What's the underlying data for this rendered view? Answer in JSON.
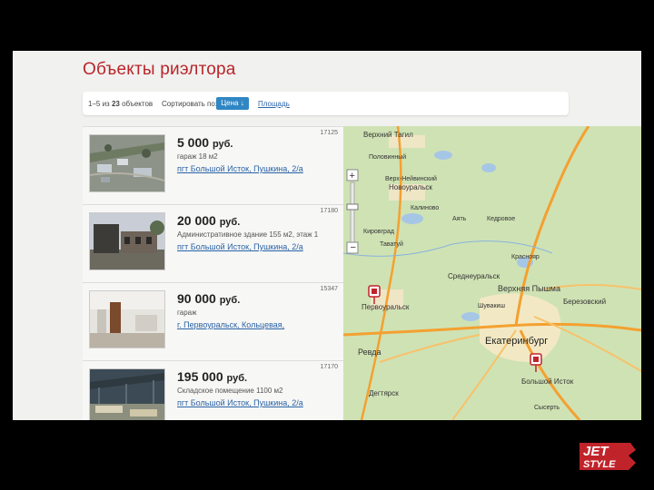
{
  "page": {
    "title": "Объекты риэлтора"
  },
  "toolbar": {
    "count_prefix": "1–5 из",
    "count_total": "23",
    "count_suffix": "объектов",
    "sort_label": "Сортировать по:",
    "sort_price": "Цена ↓",
    "sort_area": "Площадь"
  },
  "listings": [
    {
      "price": "5 000",
      "currency": "руб.",
      "desc": "гараж 18 м2",
      "address": "пгт Большой Исток, Пушкина, 2/а",
      "code": "17125"
    },
    {
      "price": "20 000",
      "currency": "руб.",
      "desc": "Административное здание 155 м2, этаж 1",
      "address": "пгт Большой Исток, Пушкина, 2/а",
      "code": "17180"
    },
    {
      "price": "90 000",
      "currency": "руб.",
      "desc": "гараж",
      "address": "г. Первоуральск, Кольцевая,",
      "code": "15347"
    },
    {
      "price": "195 000",
      "currency": "руб.",
      "desc": "Складское помещение 1100 м2",
      "address": "пгт Большой Исток, Пушкина, 2/а",
      "code": "17170"
    }
  ],
  "map": {
    "labels": {
      "l1": "Верхний Тагил",
      "l2": "Половинный",
      "l3": "Верх-Нейвинский",
      "l4": "Новоуральск",
      "l5": "Калиново",
      "l6": "Кировград",
      "l7": "Аять",
      "l8": "Таватуй",
      "l9": "Краснояр",
      "l10": "Первоуральск",
      "l11": "Среднеуральск",
      "l12": "Верхняя Пышма",
      "l13": "Березовский",
      "l14": "Ревда",
      "l15": "Екатеринбург",
      "l16": "Дегтярск",
      "l17": "Большой Исток",
      "l18": "Кедровое",
      "l19": "Шувакиш",
      "l20": "Сысерть"
    }
  },
  "logo": {
    "line1": "JET",
    "line2": "STYLE"
  },
  "colors": {
    "accent": "#b8252a",
    "link": "#2a63a8",
    "button": "#2f86c4"
  }
}
